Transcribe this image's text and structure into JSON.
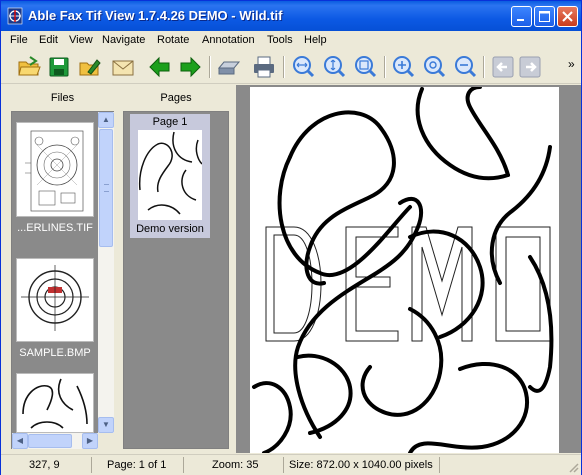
{
  "window": {
    "title": "Able Fax Tif View 1.7.4.26 DEMO  - Wild.tif",
    "controls": [
      "minimize",
      "maximize",
      "close"
    ]
  },
  "menu": [
    "File",
    "Edit",
    "View",
    "Navigate",
    "Rotate",
    "Annotation",
    "Tools",
    "Help"
  ],
  "toolbar": {
    "tools": [
      {
        "name": "open-folder-icon",
        "color": "#e8b020"
      },
      {
        "name": "save-icon",
        "color": "#1e9a3a"
      },
      {
        "name": "edit-document-icon",
        "color": "#e8b020"
      },
      {
        "name": "email-icon",
        "color": "#e0c070"
      },
      {
        "name": "arrow-left-icon",
        "color": "#1ca01c"
      },
      {
        "name": "arrow-right-icon",
        "color": "#1ca01c"
      },
      {
        "name": "scanner-icon",
        "color": "#8090a8"
      },
      {
        "name": "printer-icon",
        "color": "#5a6a80"
      },
      {
        "name": "fit-width-icon",
        "color": "#3a7ad8"
      },
      {
        "name": "fit-height-icon",
        "color": "#3a7ad8"
      },
      {
        "name": "fit-page-icon",
        "color": "#3a7ad8"
      },
      {
        "name": "zoom-in-icon",
        "color": "#3a7ad8"
      },
      {
        "name": "zoom-actual-icon",
        "color": "#3a7ad8"
      },
      {
        "name": "zoom-out-icon",
        "color": "#3a7ad8"
      },
      {
        "name": "previous-page-icon",
        "color": "#9aa0b0"
      },
      {
        "name": "next-page-icon",
        "color": "#9aa0b0"
      }
    ],
    "overflow": "»"
  },
  "files_panel": {
    "header": "Files",
    "items": [
      {
        "label": "...ERLINES.TIF"
      },
      {
        "label": "SAMPLE.BMP"
      },
      {
        "label": ""
      }
    ]
  },
  "pages_panel": {
    "header": "Pages",
    "items": [
      {
        "title": "Page 1",
        "caption": "Demo version"
      }
    ]
  },
  "viewer": {
    "watermark": "DEMO"
  },
  "statusbar": {
    "coords": "327, 9",
    "page": "Page: 1 of 1",
    "zoom": "Zoom: 35",
    "size": "Size: 872.00 x 1040.00 pixels"
  },
  "colors": {
    "titlebar": "#0c59e4",
    "panel_bg": "#8a8a8a",
    "selected_page": "#c7c9dc",
    "chrome": "#ece9d8"
  }
}
